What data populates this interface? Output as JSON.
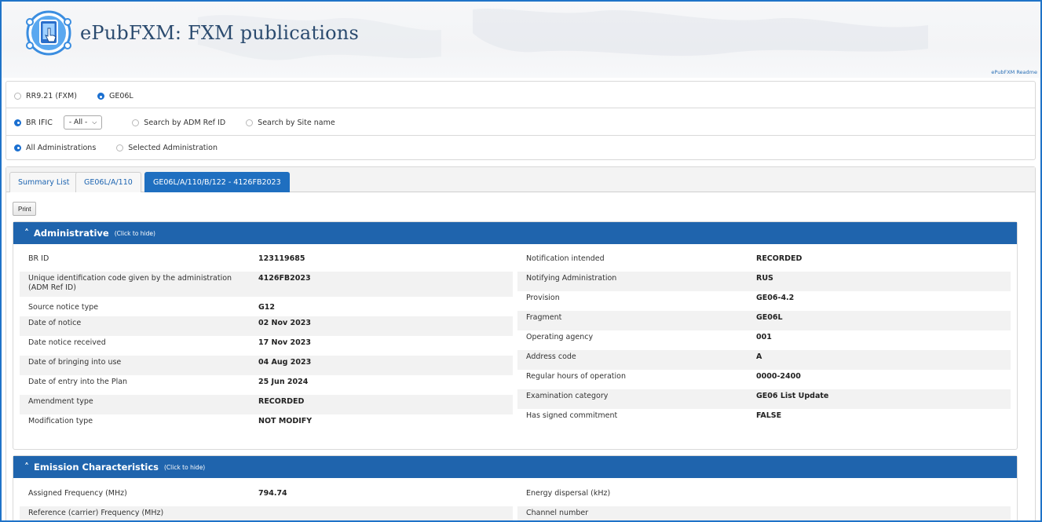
{
  "header": {
    "app_title": "ePubFXM: FXM publications",
    "readme_link": "ePubFXM Readme",
    "logo_icon": "tablet-touch-icon"
  },
  "filters": {
    "row1": [
      {
        "label": "RR9.21 (FXM)",
        "selected": false
      },
      {
        "label": "GE06L",
        "selected": true
      }
    ],
    "row2": {
      "br_ific_label": "BR IFIC",
      "br_ific_selected": true,
      "select_value": "- All -",
      "adm_ref_label": "Search by ADM Ref ID",
      "site_name_label": "Search by Site name"
    },
    "row3": [
      {
        "label": "All Administrations",
        "selected": true
      },
      {
        "label": "Selected Administration",
        "selected": false
      }
    ]
  },
  "tabs": [
    {
      "label": "Summary List",
      "active": false
    },
    {
      "label": "GE06L/A/110",
      "active": false
    },
    {
      "label": "GE06L/A/110/B/122 - 4126FB2023",
      "active": true
    }
  ],
  "print_label": "Print",
  "administrative": {
    "title": "Administrative",
    "hint": "(Click to hide)",
    "left": [
      {
        "k": "BR ID",
        "v": "123119685"
      },
      {
        "k": "Unique identification code given by the administration (ADM Ref ID)",
        "v": "4126FB2023"
      },
      {
        "k": "Source notice type",
        "v": "G12"
      },
      {
        "k": "Date of notice",
        "v": "02 Nov 2023"
      },
      {
        "k": "Date notice received",
        "v": "17 Nov 2023"
      },
      {
        "k": "Date of bringing into use",
        "v": "04 Aug 2023"
      },
      {
        "k": "Date of entry into the Plan",
        "v": "25 Jun 2024"
      },
      {
        "k": "Amendment type",
        "v": "RECORDED"
      },
      {
        "k": "Modification type",
        "v": "NOT MODIFY"
      }
    ],
    "right": [
      {
        "k": "Notification intended",
        "v": "RECORDED"
      },
      {
        "k": "Notifying Administration",
        "v": "RUS"
      },
      {
        "k": "Provision",
        "v": "GE06-4.2"
      },
      {
        "k": "Fragment",
        "v": "GE06L"
      },
      {
        "k": "Operating agency",
        "v": "001"
      },
      {
        "k": "Address code",
        "v": "A"
      },
      {
        "k": "Regular hours of operation",
        "v": "0000-2400"
      },
      {
        "k": "Examination category",
        "v": "GE06 List Update"
      },
      {
        "k": "Has signed commitment",
        "v": "FALSE"
      }
    ]
  },
  "emission": {
    "title": "Emission Characteristics",
    "hint": "(Click to hide)",
    "left": [
      {
        "k": "Assigned Frequency (MHz)",
        "v": "794.74"
      },
      {
        "k": "Reference (carrier) Frequency (MHz)",
        "v": ""
      }
    ],
    "right": [
      {
        "k": "Energy dispersal (kHz)",
        "v": ""
      },
      {
        "k": "Channel number",
        "v": ""
      }
    ]
  }
}
